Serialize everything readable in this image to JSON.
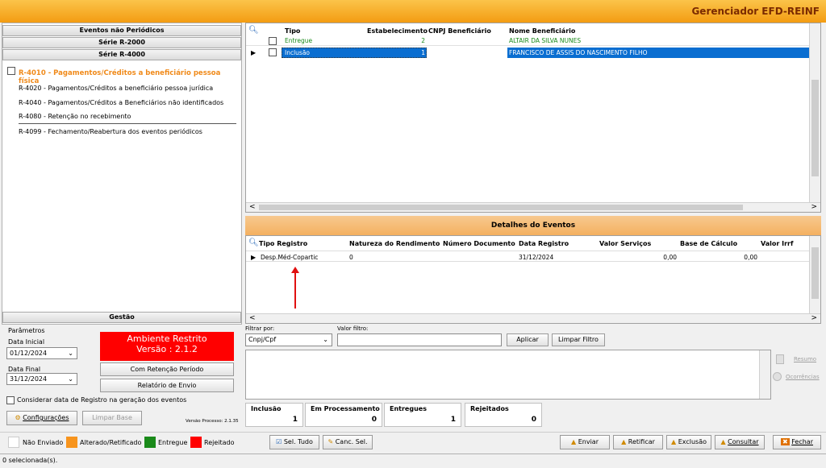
{
  "app": {
    "title": "Gerenciador EFD-REINF"
  },
  "left": {
    "section1": "Eventos não Periódicos",
    "section2": "Série R-2000",
    "section3": "Série R-4000",
    "events": [
      "R-4010 - Pagamentos/Créditos a beneficiário pessoa física",
      "R-4020 - Pagamentos/Créditos a beneficiário pessoa jurídica",
      "R-4040 - Pagamentos/Créditos a Beneficiários não identificados",
      "R-4080 - Retenção no recebimento",
      "R-4099 - Fechamento/Reabertura dos eventos periódicos"
    ],
    "gestao": "Gestão"
  },
  "grid": {
    "headers": [
      "Tipo",
      "Estabelecimento",
      "CNPJ Beneficiário",
      "Nome Beneficiário"
    ],
    "rows": [
      {
        "tipo": "Entregue",
        "estab": "2",
        "cnpj": "",
        "nome": "ALTAIR DA SILVA NUNES"
      },
      {
        "tipo": "Inclusão",
        "estab": "1",
        "cnpj": "",
        "nome": "FRANCISCO DE ASSIS DO NASCIMENTO FILHO"
      }
    ]
  },
  "details": {
    "title": "Detalhes do Eventos",
    "headers": [
      "Tipo Registro",
      "Natureza do Rendimento",
      "Número Documento",
      "Data Registro",
      "Valor Serviços",
      "Base de Cálculo",
      "Valor Irrf"
    ],
    "row": {
      "tipo": "Desp.Méd-Copartic",
      "natureza": "0",
      "numero": "",
      "data": "31/12/2024",
      "valor": "0,00",
      "base": "0,00",
      "irrf": ""
    }
  },
  "params": {
    "title": "Parâmetros",
    "data_inicial_label": "Data Inicial",
    "data_inicial": "01/12/2024",
    "data_final_label": "Data Final",
    "data_final": "31/12/2024",
    "ambiente": "Ambiente Restrito",
    "versao": "Versão : 2.1.2",
    "btn_retencao": "Com Retenção Período",
    "btn_relatorio": "Relatório de Envio",
    "checkbox_label": "Considerar data de Registro na geração dos eventos",
    "btn_config": "Configurações",
    "btn_limpar_base": "Limpar Base",
    "versao_processo": "Versão Processo: 2.1.35"
  },
  "filter": {
    "filtrar_label": "Filtrar por:",
    "filtrar_value": "Cnpj/Cpf",
    "valor_label": "Valor filtro:",
    "valor_value": "",
    "btn_aplicar": "Aplicar",
    "btn_limpar": "Limpar Filtro",
    "resumo": "Resumo",
    "ocorrencias": "Ocorrências"
  },
  "counters": [
    {
      "label": "Inclusão",
      "value": "1"
    },
    {
      "label": "Em Processamento",
      "value": "0"
    },
    {
      "label": "Entregues",
      "value": "1"
    },
    {
      "label": "Rejeitados",
      "value": "0"
    }
  ],
  "legend": [
    {
      "label": "Não Enviado",
      "color": "#ffffff"
    },
    {
      "label": "Alterado/Retificado",
      "color": "#f7941d"
    },
    {
      "label": "Entregue",
      "color": "#1a8a1a"
    },
    {
      "label": "Rejeitado",
      "color": "#ff0000"
    }
  ],
  "actions": {
    "sel_tudo": "Sel. Tudo",
    "canc_sel": "Canc. Sel.",
    "enviar": "Enviar",
    "retificar": "Retificar",
    "exclusao": "Exclusão",
    "consultar": "Consultar",
    "fechar": "Fechar"
  },
  "status": {
    "text": "0 selecionada(s)."
  },
  "colors": {
    "accent_orange": "#f39c12",
    "selected_row": "#0a6ed1",
    "ambiente_red": "#ff0000"
  }
}
